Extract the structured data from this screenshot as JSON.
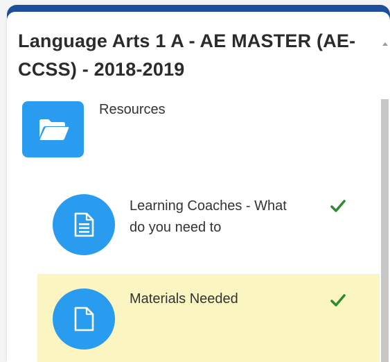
{
  "course": {
    "title": "Language Arts 1 A - AE MASTER (AE-CCSS) - 2018-2019"
  },
  "folder": {
    "label": "Resources",
    "icon": "folder-open-icon",
    "color": "#2a9cf0"
  },
  "items": [
    {
      "label": "Learning Coaches - What do you need to",
      "icon": "document-lines-icon",
      "status": "completed",
      "status_icon": "checkmark-icon",
      "highlighted": false
    },
    {
      "label": "Materials Needed",
      "icon": "document-icon",
      "status": "completed",
      "status_icon": "checkmark-icon",
      "highlighted": true
    }
  ],
  "colors": {
    "header_bar": "#1b4f9c",
    "accent_blue": "#2a9cf0",
    "check_green": "#2e8b2e",
    "highlight_bg": "#fbf5c2"
  }
}
